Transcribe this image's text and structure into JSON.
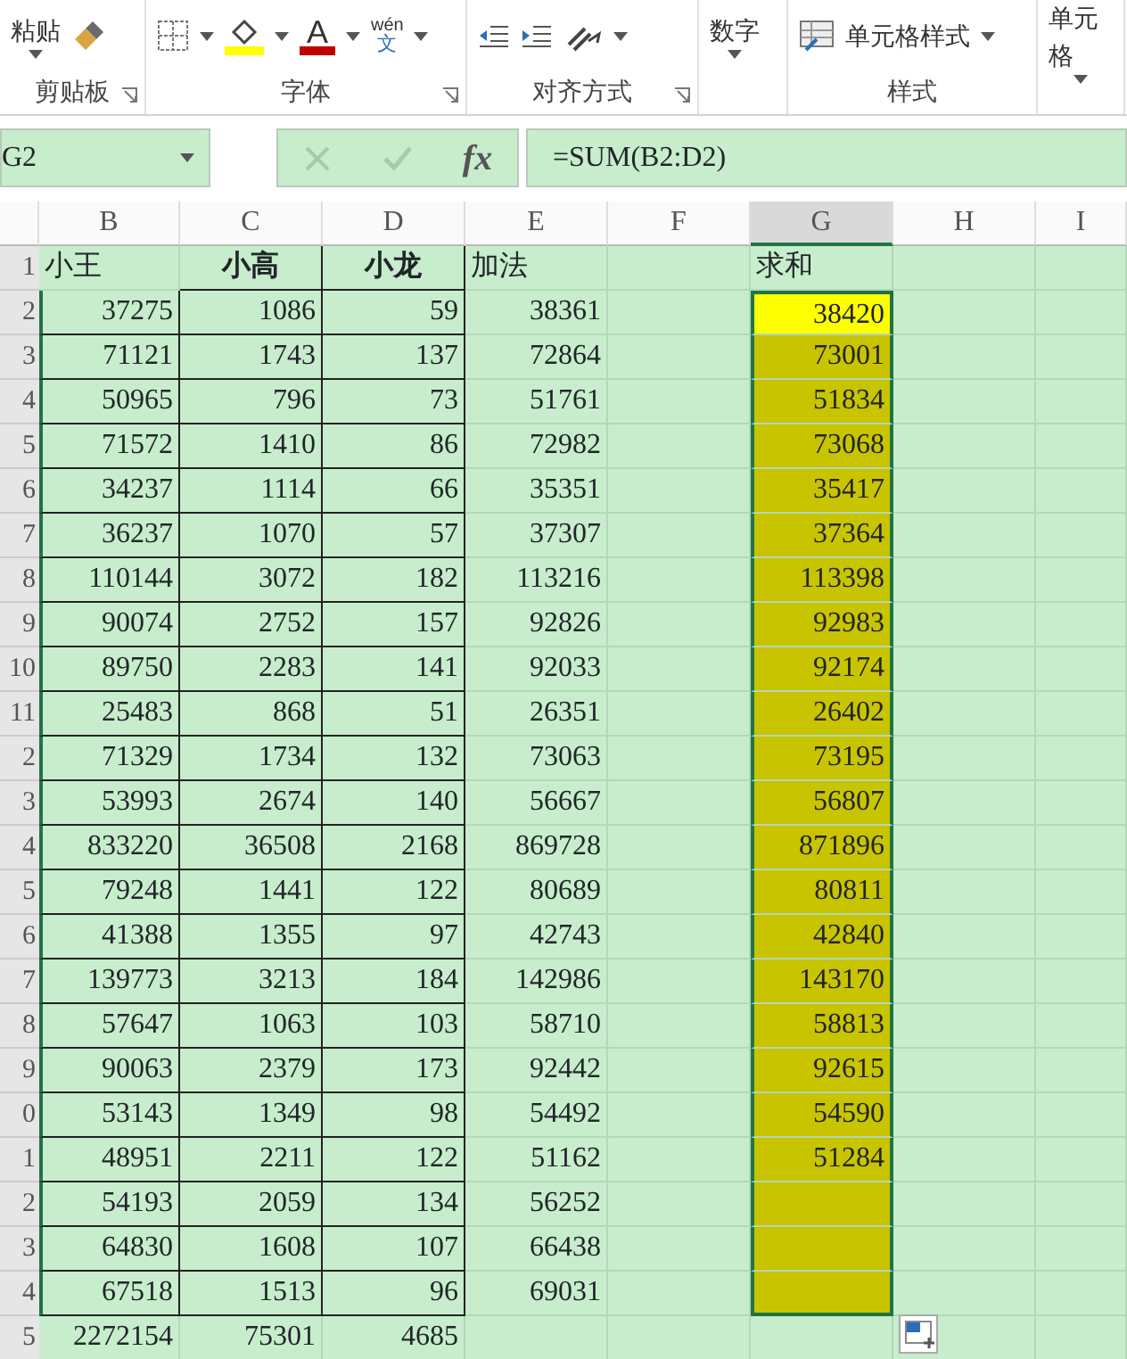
{
  "ribbon": {
    "groups": [
      {
        "kind": "clipboard",
        "label": "剪贴板",
        "launcher": true,
        "texts": [
          "粘贴"
        ]
      },
      {
        "kind": "font",
        "label": "字体",
        "launcher": true,
        "texts": [
          "A",
          "wén",
          "文"
        ]
      },
      {
        "kind": "alignment",
        "label": "对齐方式",
        "launcher": true
      },
      {
        "kind": "number",
        "launcher": false,
        "texts": [
          "数字"
        ]
      },
      {
        "kind": "styles",
        "label": "样式",
        "launcher": false,
        "texts": [
          "单元格样式"
        ]
      },
      {
        "kind": "cells",
        "launcher": false,
        "texts": [
          "单元格"
        ]
      }
    ]
  },
  "formula_bar": {
    "name_box": "G2",
    "function_label": "fx",
    "formula": "=SUM(B2:D2)"
  },
  "sheet": {
    "columns": [
      {
        "label": "B",
        "selected": false
      },
      {
        "label": "C",
        "selected": false
      },
      {
        "label": "D",
        "selected": false
      },
      {
        "label": "E",
        "selected": false
      },
      {
        "label": "F",
        "selected": false
      },
      {
        "label": "G",
        "selected": true
      },
      {
        "label": "H",
        "selected": false
      },
      {
        "label": "I",
        "selected": false
      }
    ],
    "rows": [
      {
        "header": "1",
        "kind": "header",
        "bold": [
          false,
          true,
          true,
          false,
          false,
          false,
          false,
          false
        ],
        "cells": [
          "小王",
          "小高",
          "小龙",
          "加法",
          "",
          "求和",
          "",
          ""
        ],
        "sum_selected": false,
        "sum_active": false
      },
      {
        "header": "2",
        "kind": "data",
        "cells": [
          "37275",
          "1086",
          "59",
          "38361",
          "",
          "38420",
          "",
          ""
        ],
        "sum_selected": true,
        "sum_active": true
      },
      {
        "header": "3",
        "kind": "data",
        "cells": [
          "71121",
          "1743",
          "137",
          "72864",
          "",
          "73001",
          "",
          ""
        ],
        "sum_selected": true,
        "sum_active": false
      },
      {
        "header": "4",
        "kind": "data",
        "cells": [
          "50965",
          "796",
          "73",
          "51761",
          "",
          "51834",
          "",
          ""
        ],
        "sum_selected": true,
        "sum_active": false
      },
      {
        "header": "5",
        "kind": "data",
        "cells": [
          "71572",
          "1410",
          "86",
          "72982",
          "",
          "73068",
          "",
          ""
        ],
        "sum_selected": true,
        "sum_active": false
      },
      {
        "header": "6",
        "kind": "data",
        "cells": [
          "34237",
          "1114",
          "66",
          "35351",
          "",
          "35417",
          "",
          ""
        ],
        "sum_selected": true,
        "sum_active": false
      },
      {
        "header": "7",
        "kind": "data",
        "cells": [
          "36237",
          "1070",
          "57",
          "37307",
          "",
          "37364",
          "",
          ""
        ],
        "sum_selected": true,
        "sum_active": false
      },
      {
        "header": "8",
        "kind": "data",
        "cells": [
          "110144",
          "3072",
          "182",
          "113216",
          "",
          "113398",
          "",
          ""
        ],
        "sum_selected": true,
        "sum_active": false
      },
      {
        "header": "9",
        "kind": "data",
        "cells": [
          "90074",
          "2752",
          "157",
          "92826",
          "",
          "92983",
          "",
          ""
        ],
        "sum_selected": true,
        "sum_active": false
      },
      {
        "header": "10",
        "kind": "data",
        "cells": [
          "89750",
          "2283",
          "141",
          "92033",
          "",
          "92174",
          "",
          ""
        ],
        "sum_selected": true,
        "sum_active": false
      },
      {
        "header": "11",
        "kind": "data",
        "cells": [
          "25483",
          "868",
          "51",
          "26351",
          "",
          "26402",
          "",
          ""
        ],
        "sum_selected": true,
        "sum_active": false
      },
      {
        "header": "2",
        "kind": "data",
        "cells": [
          "71329",
          "1734",
          "132",
          "73063",
          "",
          "73195",
          "",
          ""
        ],
        "sum_selected": true,
        "sum_active": false
      },
      {
        "header": "3",
        "kind": "data",
        "cells": [
          "53993",
          "2674",
          "140",
          "56667",
          "",
          "56807",
          "",
          ""
        ],
        "sum_selected": true,
        "sum_active": false
      },
      {
        "header": "4",
        "kind": "data",
        "cells": [
          "833220",
          "36508",
          "2168",
          "869728",
          "",
          "871896",
          "",
          ""
        ],
        "sum_selected": true,
        "sum_active": false
      },
      {
        "header": "5",
        "kind": "data",
        "cells": [
          "79248",
          "1441",
          "122",
          "80689",
          "",
          "80811",
          "",
          ""
        ],
        "sum_selected": true,
        "sum_active": false
      },
      {
        "header": "6",
        "kind": "data",
        "cells": [
          "41388",
          "1355",
          "97",
          "42743",
          "",
          "42840",
          "",
          ""
        ],
        "sum_selected": true,
        "sum_active": false
      },
      {
        "header": "7",
        "kind": "data",
        "cells": [
          "139773",
          "3213",
          "184",
          "142986",
          "",
          "143170",
          "",
          ""
        ],
        "sum_selected": true,
        "sum_active": false
      },
      {
        "header": "8",
        "kind": "data",
        "cells": [
          "57647",
          "1063",
          "103",
          "58710",
          "",
          "58813",
          "",
          ""
        ],
        "sum_selected": true,
        "sum_active": false
      },
      {
        "header": "9",
        "kind": "data",
        "cells": [
          "90063",
          "2379",
          "173",
          "92442",
          "",
          "92615",
          "",
          ""
        ],
        "sum_selected": true,
        "sum_active": false
      },
      {
        "header": "0",
        "kind": "data",
        "cells": [
          "53143",
          "1349",
          "98",
          "54492",
          "",
          "54590",
          "",
          ""
        ],
        "sum_selected": true,
        "sum_active": false
      },
      {
        "header": "1",
        "kind": "data",
        "cells": [
          "48951",
          "2211",
          "122",
          "51162",
          "",
          "51284",
          "",
          ""
        ],
        "sum_selected": true,
        "sum_active": false
      },
      {
        "header": "2",
        "kind": "data",
        "cells": [
          "54193",
          "2059",
          "134",
          "56252",
          "",
          "",
          "",
          ""
        ],
        "sum_selected": true,
        "sum_active": false
      },
      {
        "header": "3",
        "kind": "data",
        "cells": [
          "64830",
          "1608",
          "107",
          "66438",
          "",
          "",
          "",
          ""
        ],
        "sum_selected": true,
        "sum_active": false
      },
      {
        "header": "4",
        "kind": "data",
        "cells": [
          "67518",
          "1513",
          "96",
          "69031",
          "",
          "",
          "",
          ""
        ],
        "sum_selected": true,
        "sum_active": false
      },
      {
        "header": "5",
        "kind": "total",
        "cells": [
          "2272154",
          "75301",
          "4685",
          "",
          "",
          "",
          "",
          ""
        ],
        "sum_selected": false,
        "sum_active": false
      }
    ]
  }
}
